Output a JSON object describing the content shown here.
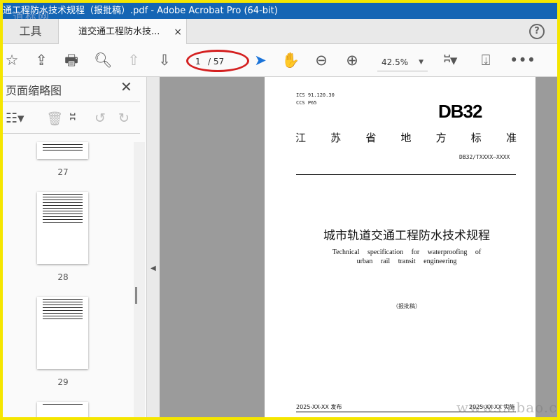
{
  "window": {
    "title": "通工程防水技术规程（报批稿）.pdf - Adobe Acrobat Pro (64-bit)"
  },
  "tabs": [
    {
      "label": "工具"
    },
    {
      "label": "道交通工程防水技...",
      "close": "×"
    }
  ],
  "toolbar": {
    "current_page": "1",
    "total_pages": "/ 57",
    "zoom": "42.5%"
  },
  "left_panel": {
    "title": "页面缩略图",
    "close": "✕",
    "thumbnails": [
      {
        "label": "27"
      },
      {
        "label": "28"
      },
      {
        "label": "29"
      }
    ]
  },
  "document": {
    "ics": "ICS  91.120.30",
    "ccs": "CCS  P65",
    "code": "DB32",
    "standard_chars": [
      "江",
      "苏",
      "省",
      "地",
      "方",
      "标",
      "准"
    ],
    "standard_number": "DB32/TXXXX—XXXX",
    "title": "城市轨道交通工程防水技术规程",
    "english_title_1": "Technical specification for waterproofing of",
    "english_title_2": "urban rail transit engineering",
    "draft": "（报批稿）",
    "publish": "2025-XX-XX 发布",
    "implement": "2025-XX-XX 实施"
  },
  "watermarks": [
    "道标网",
    "www.cnbao.c"
  ],
  "colors": {
    "titlebar": "#1565b4",
    "select_tool": "#1a73d9",
    "annotation": "#d42020",
    "border": "#f5e600"
  }
}
